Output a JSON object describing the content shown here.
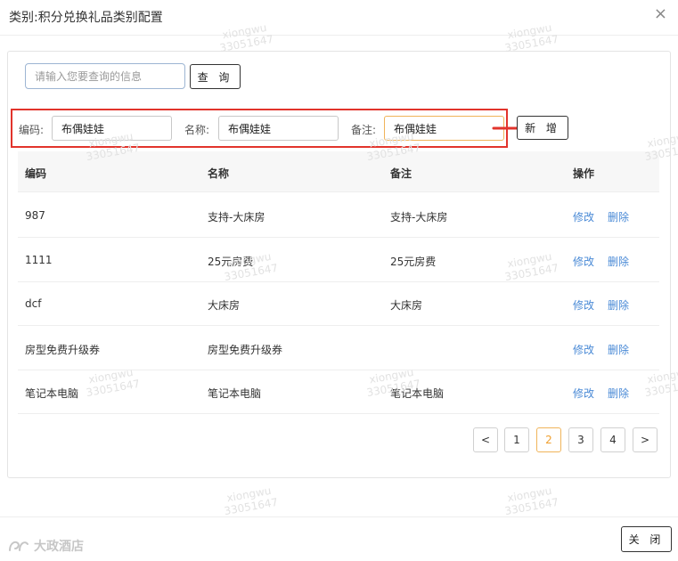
{
  "dialog": {
    "title": "类别:积分兑换礼品类别配置",
    "close_glyph": "×"
  },
  "search": {
    "placeholder": "请输入您要查询的信息",
    "button_label": "查 询"
  },
  "form": {
    "code_label": "编码:",
    "code_value": "布偶娃娃",
    "name_label": "名称:",
    "name_value": "布偶娃娃",
    "remark_label": "备注:",
    "remark_value": "布偶娃娃",
    "add_label": "新 增"
  },
  "table": {
    "headers": [
      "编码",
      "名称",
      "备注",
      "操作"
    ],
    "rows": [
      {
        "code": "987",
        "name": "支持-大床房",
        "remark": "支持-大床房"
      },
      {
        "code": "1111",
        "name": "25元房费",
        "remark": "25元房费"
      },
      {
        "code": "dcf",
        "name": "大床房",
        "remark": "大床房"
      },
      {
        "code": "房型免费升级券",
        "name": "房型免费升级券",
        "remark": ""
      },
      {
        "code": "笔记本电脑",
        "name": "笔记本电脑",
        "remark": "笔记本电脑"
      }
    ],
    "edit_label": "修改",
    "delete_label": "删除"
  },
  "pagination": {
    "prev": "<",
    "pages": [
      "1",
      "2",
      "3",
      "4"
    ],
    "current": "2",
    "next": ">"
  },
  "footer": {
    "close_label": "关 闭"
  },
  "logo": {
    "text": "大政酒店"
  },
  "watermark": {
    "text": "xiongwu\n33051647"
  },
  "colors": {
    "highlight": "#e2342c",
    "link": "#4a8ad6",
    "active_page": "#f0a030"
  }
}
